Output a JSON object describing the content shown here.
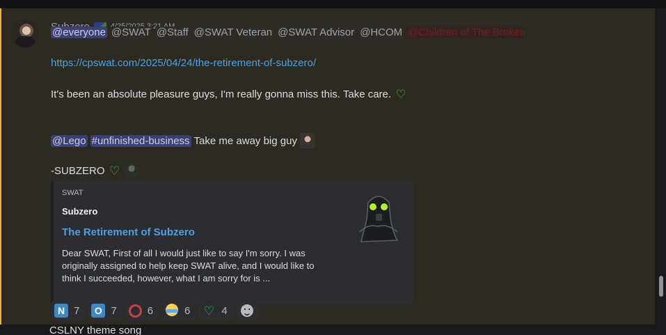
{
  "message": {
    "username": "Subzero",
    "timestamp": "4/25/2025 3:21 AM",
    "mentions": {
      "everyone": "@everyone",
      "swat": "@SWAT",
      "staff": "@Staff",
      "veteran": "@SWAT Veteran",
      "advisor": "@SWAT Advisor",
      "hcom": "@HCOM",
      "hidden_role": "@Children of The Broken"
    },
    "link": "https://cpswat.com/2025/04/24/the-retirement-of-subzero/",
    "farewell": "It's been an absolute pleasure guys, I'm really gonna miss this. Take care.",
    "heart_emoji": "♡",
    "lego_mention": "@Lego",
    "channel_mention": "#unfinished-business",
    "take_away": "Take me away big guy",
    "signature": "-SUBZERO"
  },
  "embed": {
    "provider": "SWAT",
    "author": "Subzero",
    "title": "The Retirement of Subzero",
    "description": "Dear SWAT, First of all I would just like to say I'm sorry. I was originally assigned to help keep SWAT alive, and I would like to think I succeeded, however, what I am sorry for is ..."
  },
  "reactions": [
    {
      "emoji": "N",
      "count": "7"
    },
    {
      "emoji": "O",
      "count": "7"
    },
    {
      "emoji": "red-circle",
      "count": "6"
    },
    {
      "emoji": "crying-face",
      "count": "6"
    },
    {
      "emoji": "green-heart",
      "count": "4"
    }
  ],
  "next_message": {
    "text": "CSLNY theme song"
  },
  "colors": {
    "link": "#4aa3e8",
    "highlight_border": "#f0b232",
    "mention_bg": "#3c4270"
  }
}
